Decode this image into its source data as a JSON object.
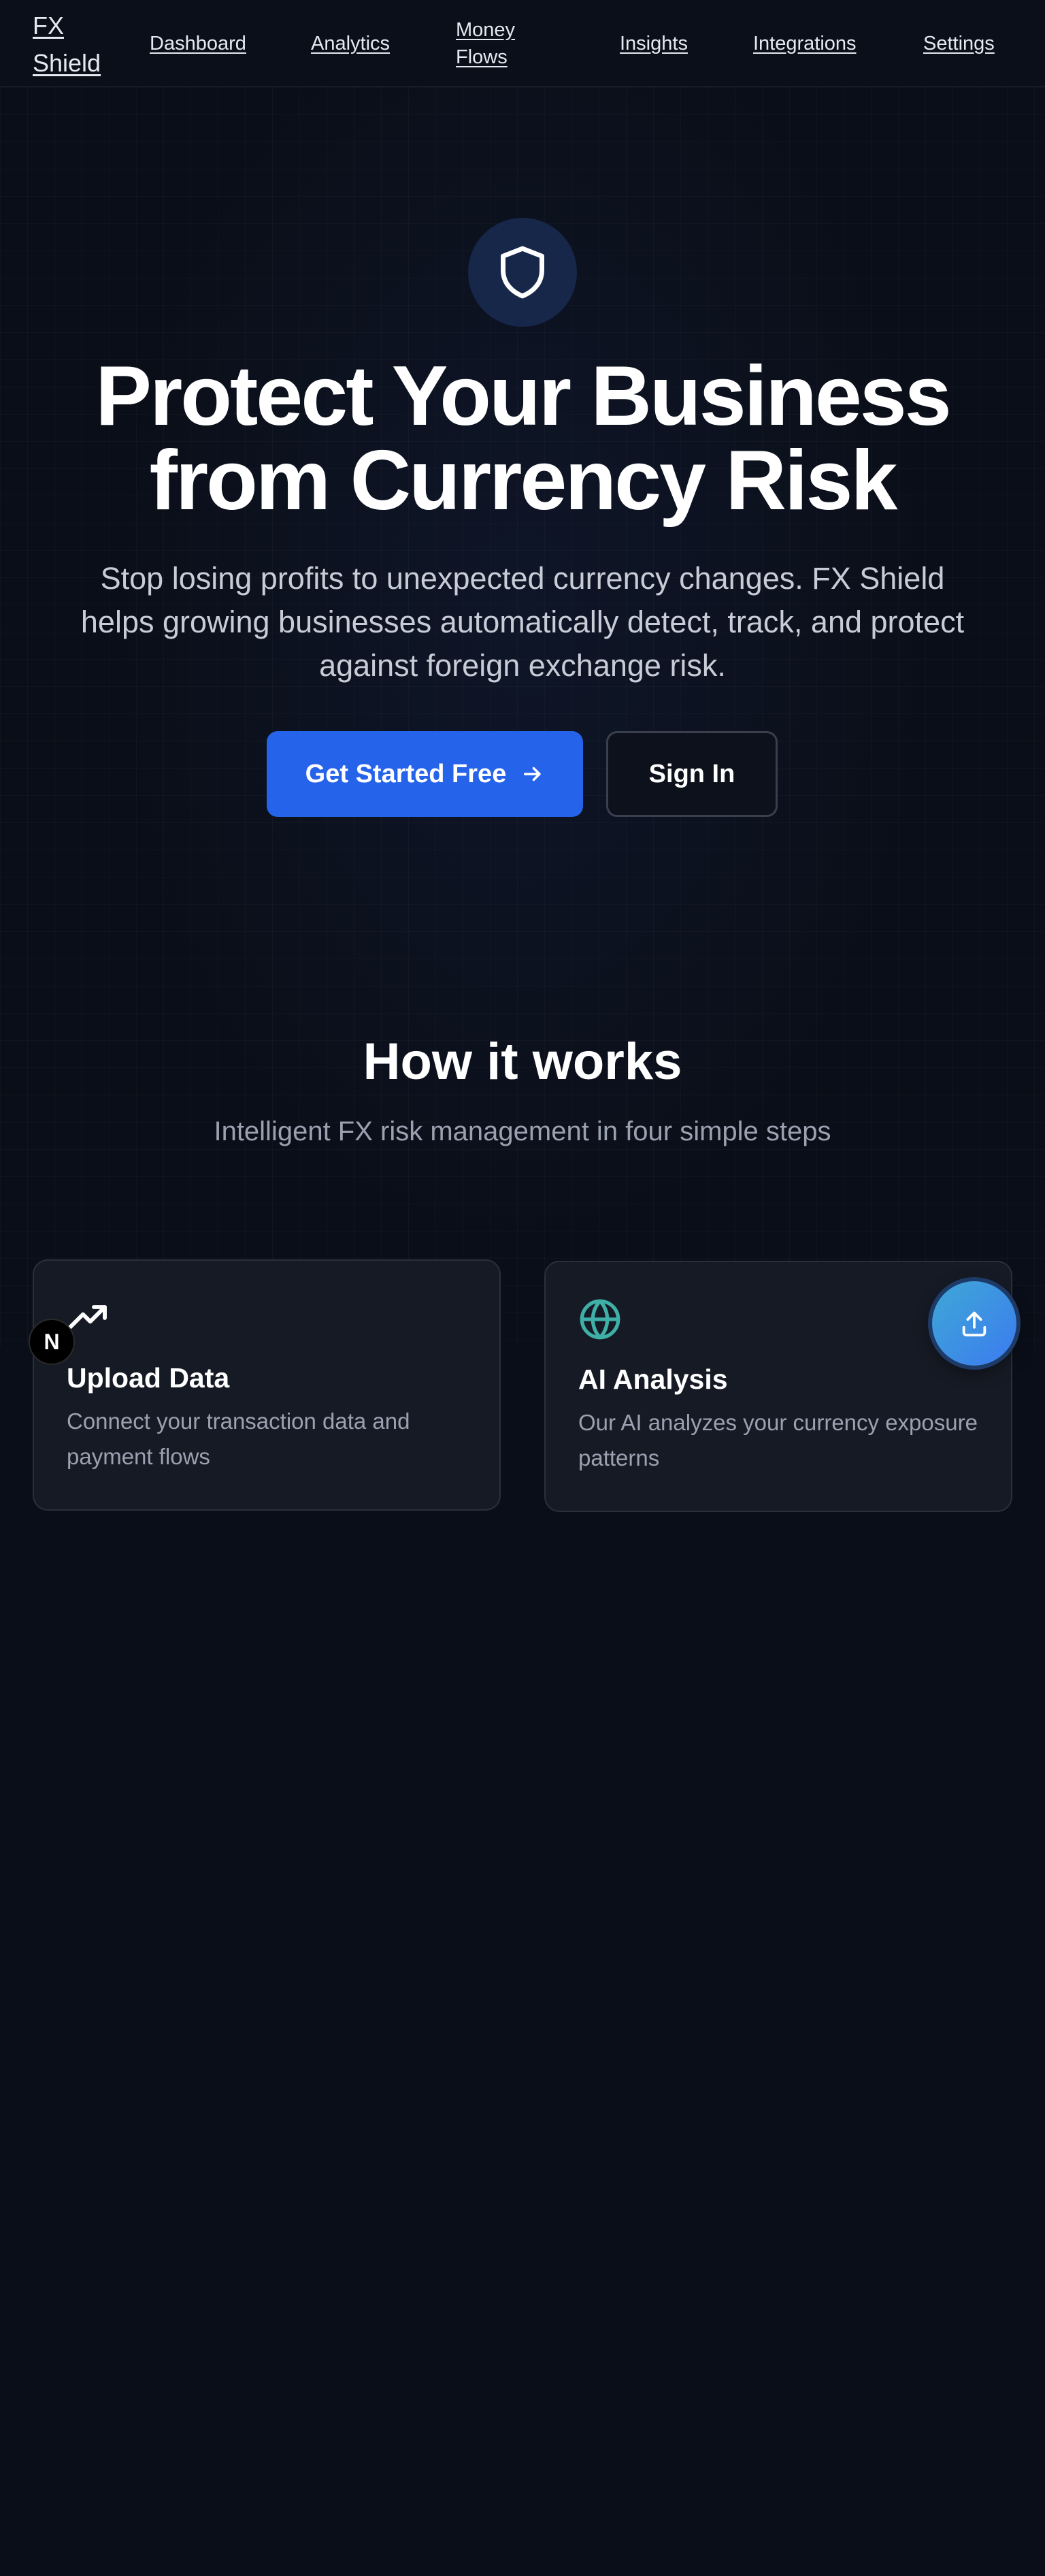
{
  "nav": {
    "brand": "FX Shield",
    "items": [
      {
        "label": "Dashboard"
      },
      {
        "label": "Analytics"
      },
      {
        "label": "Money Flows"
      },
      {
        "label": "Insights"
      },
      {
        "label": "Integrations"
      },
      {
        "label": "Settings"
      }
    ]
  },
  "hero": {
    "icon": "shield-icon",
    "title": "Protect Your Business from Currency Risk",
    "subtitle": "Stop losing profits to unexpected currency changes. FX Shield helps growing businesses automatically detect, track, and protect against foreign exchange risk.",
    "primary_cta": "Get Started Free",
    "primary_cta_icon": "arrow-right-icon",
    "secondary_cta": "Sign In"
  },
  "how_it_works": {
    "title": "How it works",
    "subtitle": "Intelligent FX risk management in four simple steps",
    "steps": [
      {
        "icon": "trending-up-icon",
        "title": "Upload Data",
        "description": "Connect your transaction data and payment flows"
      },
      {
        "icon": "globe-icon",
        "title": "AI Analysis",
        "description": "Our AI analyzes your currency exposure patterns"
      }
    ]
  },
  "widgets": {
    "n_badge_label": "N",
    "upload_icon": "upload-icon"
  },
  "colors": {
    "background": "#0a0e18",
    "primary": "#2563eb",
    "shield_bg": "#17274a",
    "globe_accent": "#3fb0a8"
  }
}
